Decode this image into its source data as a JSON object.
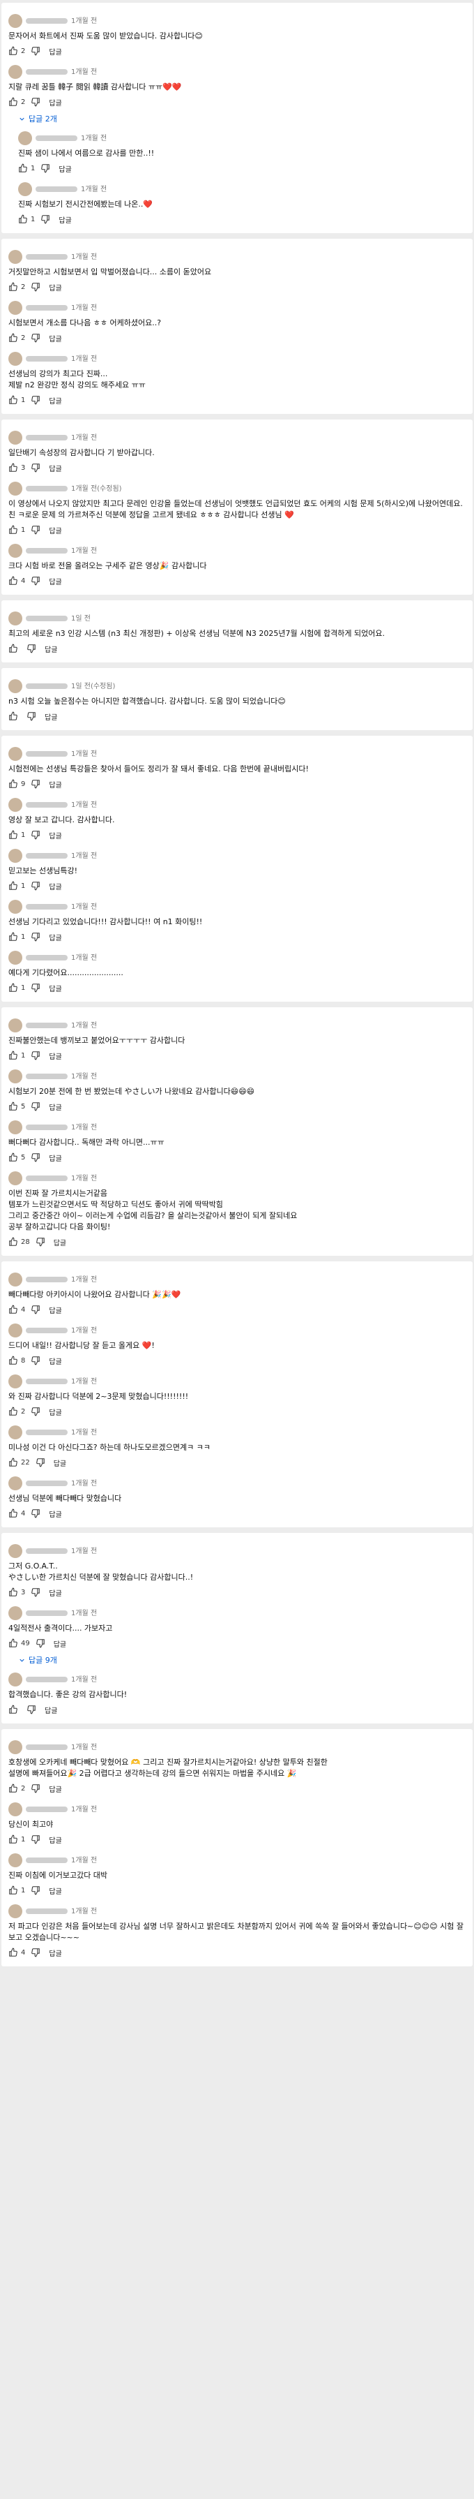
{
  "like_icon": "thumbs-up-icon",
  "dislike_icon": "thumbs-down-icon",
  "reply_label": "답글",
  "threads": [
    {
      "comments": [
        {
          "time": "1개월 전",
          "text": "문자어서 화트에서 진짜 도움 많이 받았습니다. 감사합니다😊",
          "likes": "2",
          "reply": false
        },
        {
          "time": "1개월 전",
          "text": "지랄 큐레 꿈틀 韓子 閱읽 韓讀 감사합니다 ㅠㅠ❤️❤️",
          "likes": "2",
          "reply": false
        }
      ],
      "more": "답글 2개",
      "replies": [
        {
          "time": "1개월 전",
          "text": "진짜 샘이 나에서 여름으로 감사를 만한..!!",
          "likes": "1",
          "reply": true
        },
        {
          "time": "1개월 전",
          "text": "진짜 시험보기 전시간전에봤는데 나온..❤️",
          "likes": "1",
          "reply": true
        }
      ]
    },
    {
      "comments": [
        {
          "time": "1개월 전",
          "text": "거짓말안하고 시험보면서 입 막벌어졌습니다... 소름이 돋았어요",
          "likes": "2",
          "reply": false
        },
        {
          "time": "1개월 전",
          "text": "시험보면서 개소름 다나음 ㅎㅎ 어케하셨어요..?",
          "likes": "2",
          "reply": false
        },
        {
          "time": "1개월 전",
          "text": "선생님의 강의가 최고다 진짜...\n제발 n2 완강만 정식 강의도 해주세요 ㅠㅠ",
          "likes": "1",
          "reply": false
        }
      ]
    },
    {
      "comments": [
        {
          "time": "1개월 전",
          "text": "일단배기 속성장의 감사합니다 기 받아갑니다.",
          "likes": "3",
          "reply": false
        },
        {
          "time": "1개월 전(수정됨)",
          "text": "이 영상에서 나오지 않았지만 최고다 문레인 인강을 들었는데 선생님이 엇뱃했도 언급되었던 효도 어케의 시험 문제 5(하시오)에 나왔어연데요. 친 ㅋ로운 문제 의 가르쳐주신 덕분에 정답을 고르게 됐네요 ㅎㅎㅎ 감사합니다 선생님 ❤️",
          "likes": "1",
          "reply": false
        },
        {
          "time": "1개월 전",
          "text": "크다 시험 바로 전을 올려오는 구세주 같은 영상🎉 감사합니다",
          "likes": "4",
          "reply": false
        }
      ]
    },
    {
      "comments": [
        {
          "time": "1일 전",
          "text": "최고의 세로운 n3 인강 시스템 (n3 최신 개정판) + 이상옥 선생님 덕분에 N3 2025년7월 시험에 합격하게 되었어요.",
          "likes": "",
          "reply": false
        }
      ]
    },
    {
      "comments": [
        {
          "time": "1일 전(수정됨)",
          "text": "n3 시험 오늘 높은점수는 아니지만 합격했습니다. 감사합니다. 도움 많이 되었습니다😊",
          "likes": "",
          "reply": false
        }
      ]
    },
    {
      "comments": [
        {
          "time": "1개월 전",
          "text": "시험전에는 선생님 특강들은 찾아서 들어도 정리가 잘 돼서 좋네요. 다음 한번에 끝내버립시다!",
          "likes": "9",
          "reply": false
        },
        {
          "time": "1개월 전",
          "text": "영상 잘 보고 갑니다. 감사합니다.",
          "likes": "1",
          "reply": false
        },
        {
          "time": "1개월 전",
          "text": "믿고보는 선생님특강!",
          "likes": "1",
          "reply": false
        },
        {
          "time": "1개월 전",
          "text": "선생님 기다리고 있었습니다!!! 감사합니다!! 여 n1 화이팅!!",
          "likes": "1",
          "reply": false
        },
        {
          "time": "1개월 전",
          "text": "예다게 기다렸어요.......................",
          "likes": "1",
          "reply": false
        }
      ]
    },
    {
      "comments": [
        {
          "time": "1개월 전",
          "text": "진짜불안했는데 뱅끼보고 붙었어요ㅜㅜㅜㅜ 감사합니다",
          "likes": "1",
          "reply": false
        },
        {
          "time": "1개월 전",
          "text": "시험보기 20분 전에 한 번 봤었는데 やさしい가 나왔네요 감사합니다😄😄😄",
          "likes": "5",
          "reply": false
        },
        {
          "time": "1개월 전",
          "text": "뻐다뻐다 감사합니다.. 독해만 과락 아니면...ㅠㅠ",
          "likes": "5",
          "reply": false
        },
        {
          "time": "1개월 전",
          "text": "이번 진짜 잘 가르치시는거같음\n템포가 느린것같으면서도 딱 적당하고 딕션도 좋아서 귀에 딱딱박힘\n그리고 중간중간 아이~ 이러는게 수업에 리듬감? 을 살리는것같아서 불안이 되게 잘되네요\n공부 잘하고갑니다 다음 화이팅!",
          "likes": "28",
          "reply": false
        }
      ]
    },
    {
      "comments": [
        {
          "time": "1개월 전",
          "text": "빼다빼다랑 아키아시이 나왔어요 감사합니다 🎉🎉❤️",
          "likes": "4",
          "reply": false
        },
        {
          "time": "1개월 전",
          "text": "드디어 내일!! 감사합니당 잘 듣고 올게요 ❤️!",
          "likes": "8",
          "reply": false
        },
        {
          "time": "1개월 전",
          "text": "와 진짜 감사합니다 덕분에 2~3문제 맞혔습니다!!!!!!!!",
          "likes": "2",
          "reply": false
        },
        {
          "time": "1개월 전",
          "text": "미나성 이건 다 아신다그죠? 하는데 하나도모르겠으면계ㅋ ㅋㅋ",
          "likes": "22",
          "reply": false
        },
        {
          "time": "1개월 전",
          "text": "선생님 덕분에 빼다빼다 맞혔습니다",
          "likes": "4",
          "reply": false
        }
      ]
    },
    {
      "comments": [
        {
          "time": "1개월 전",
          "text": "그저 G.O.A.T..\nやさしい한 가르치신 덕분에 잘 맞혔습니다 감사합니다..!",
          "likes": "3",
          "reply": false
        },
        {
          "time": "1개월 전",
          "text": "4일적전사 출격이다.... 가보자고",
          "likes": "49",
          "reply": false
        }
      ],
      "more": "답글 9개",
      "after": [
        {
          "time": "1개월 전",
          "text": "합격했습니다. 좋은 강의 감사합니다!",
          "likes": "",
          "reply": false
        }
      ]
    },
    {
      "comments": [
        {
          "time": "1개월 전",
          "text": "호창생에 오카케네 빼다빼다 맞혔어요 🫶 그리고 진짜 잘가르치시는거같아요! 상냥한 말투와 친절한\n설명에 빠져들어요🎉 2급 어렵다고 생각하는데 강의 들으면 쉬워지는 마법을 주시네요 🎉",
          "likes": "2",
          "reply": false
        },
        {
          "time": "1개월 전",
          "text": "당신이 최고야",
          "likes": "1",
          "reply": false
        },
        {
          "time": "1개월 전",
          "text": "진짜 이침에 이거보고갔다 대박",
          "likes": "1",
          "reply": false
        },
        {
          "time": "1개월 전",
          "text": "저 파고다 인강은 처음 들어보는데 강사님 설명 너무 잘하시고 밝은데도 차분함까지 있어서 귀에 쏙쏙 잘 들어와서 좋았습니다~😊😊😊 시험 잘 보고 오겠습니다~~~",
          "likes": "4",
          "reply": false
        }
      ]
    }
  ]
}
